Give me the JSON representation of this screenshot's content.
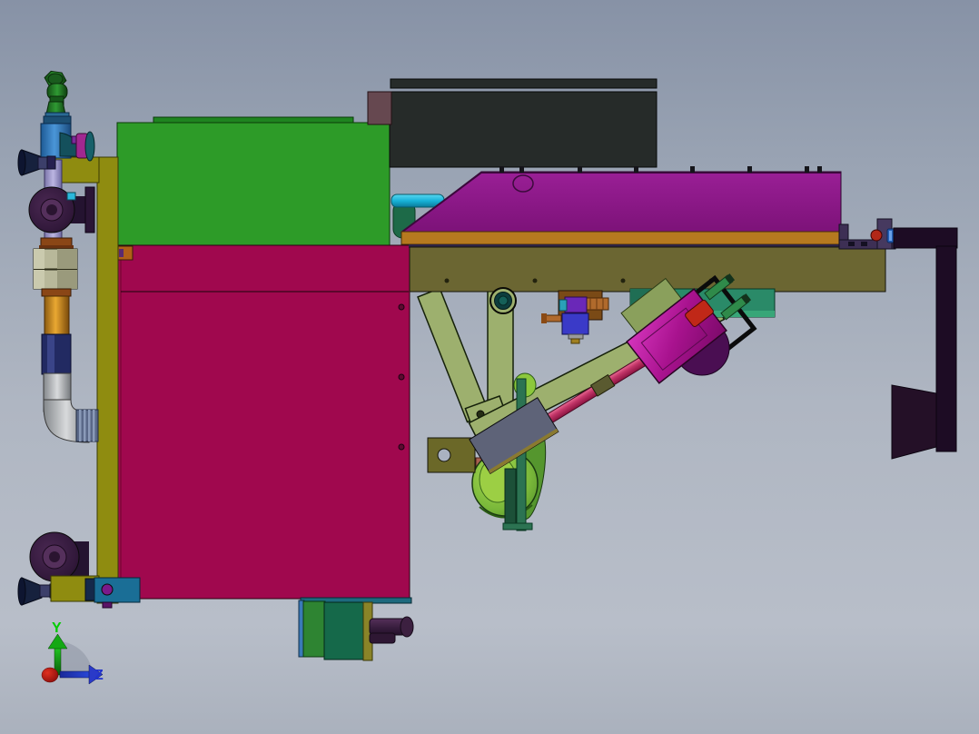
{
  "viewport": {
    "type": "cad-3d-viewport",
    "view": "side view of machine assembly"
  },
  "axis_triad": {
    "y_label": "Y",
    "z_label": "Z",
    "y_color": "#00cc00",
    "z_color": "#2233cc",
    "x_color": "#bb1111"
  },
  "palette": {
    "background_top": "#8792a6",
    "background_bottom": "#b6bcc7",
    "green_box": "#2d9b28",
    "crimson_box": "#a0084e",
    "dark_cabinet": "#262b29",
    "mauve_block": "#664850",
    "hood_purple": "#8c1a88",
    "gold_strip": "#b5791f",
    "beam_olive": "#6b6632",
    "olive_frame": "#8f8c10",
    "truss_sage": "#9db06e",
    "slate_plate": "#5e6378",
    "blower_green": "#8ac838",
    "gearbox_magenta": "#b018a0",
    "rod_pink": "#c23568",
    "teal_box_mid": "#2a8a68",
    "teal_box_small": "#1a6e96",
    "valve_blue": "#2b7ab8",
    "amber_pipe": "#d08a18",
    "navy_band": "#222a62",
    "lavender_pipe": "#a49ed2",
    "caster_purple": "#3a1f42",
    "right_arm_dark": "#1d0c24",
    "cyan_pipe": "#18b2d8",
    "handle_purple": "#3c2040"
  }
}
